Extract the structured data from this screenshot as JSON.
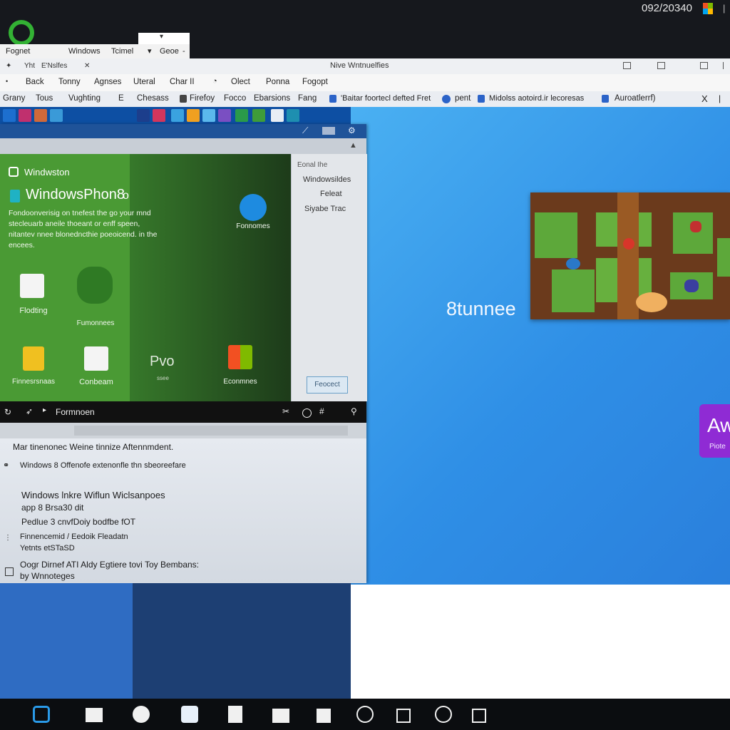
{
  "system": {
    "clock": "092/20340",
    "separator": "|"
  },
  "mini_menu": {
    "items": [
      "Fognet",
      "Windows",
      "Tcimel",
      "Geoe"
    ],
    "caret": "▾",
    "top_arrow": "▾",
    "dash": "-"
  },
  "window": {
    "title": "Nive Wntnuelfies",
    "nav_small": [
      "✦",
      "Yht",
      "E'Nslfes",
      "✕"
    ],
    "menu": [
      "Back",
      "Tonny",
      "Agnses",
      "Uteral",
      "Char II",
      "Olect",
      "Ponna",
      "Fogopt"
    ],
    "bookmarks": [
      "Grany",
      "Tous",
      "Vughting",
      "Chesass",
      "Firefoy",
      "Focco",
      "Ebarsions",
      "Fang",
      "'Baitar foortecl defted Fret",
      "pent",
      "Midolss aotoird.ir lecoresas",
      "Auroatlerrf)"
    ],
    "close_glyph": "X"
  },
  "app": {
    "brand": "Windwston",
    "heading": "WindowsPhon8",
    "heading_suffix": "o",
    "description": "Fondoonverisig on tnefest the go your mnd stecleuarb aneile thoeant or enff speen, nitantev nnee blonedncthie poeoicend. in the encees.",
    "top_tile_label": "Fonnomes",
    "tiles": [
      "Flodting",
      "Fumonnees",
      "Finnesrsnaas",
      "Conbeam",
      "Pvo",
      "Econmnes"
    ],
    "tile_sub": "ssee",
    "side_items": [
      "Eonal Ihe",
      "Windowsildes",
      "Feleat",
      "Siyabe Trac"
    ],
    "side_button": "Feocect",
    "black_bar_label": "Formnoen",
    "lower_lines": [
      "Mar tinenonec Weine tinnize  Aftennmdent.",
      "Windows 8 Offenofe extenonfle thn sbeoreefare",
      "Windows lnkre Wiflun Wiclsanpoes",
      "app 8 Brsa30 dit",
      "Pedlue 3 cnvfDoiy bodfbe fOT",
      "Finnencemid / Eedoik Fleadatn",
      "Yetnts etSTaSD",
      "Oogr Dirnef ATI Aldy Egtiere tovi Toy Bembans:",
      "by Wnnoteges"
    ]
  },
  "desktop": {
    "tunnel_text": "8tunnee",
    "purple_tile": {
      "big": "Aw",
      "small": "Piote"
    }
  },
  "taskbar_icons": [
    "edge-icon",
    "folder-icon",
    "chat-icon",
    "store-icon",
    "book-icon",
    "briefcase-icon",
    "calendar-icon",
    "music-icon",
    "settings-icon",
    "phone-icon",
    "window-icon"
  ],
  "colors": {
    "accent_blue": "#2f8fe6",
    "green": "#3c8b2c",
    "purple": "#8f2bd4"
  }
}
